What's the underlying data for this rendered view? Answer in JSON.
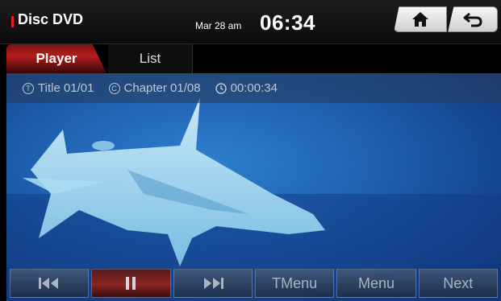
{
  "header": {
    "source_title": "Disc DVD",
    "date": "Mar 28 am",
    "time": "06:34",
    "home_icon": "home-icon",
    "back_icon": "back-arrow-icon"
  },
  "tabs": [
    {
      "label": "Player",
      "active": true
    },
    {
      "label": "List",
      "active": false
    }
  ],
  "info": {
    "title_icon": "T",
    "title": "Title 01/01",
    "chapter_icon": "C",
    "chapter": "Chapter 01/08",
    "elapsed": "00:00:34"
  },
  "controls": {
    "tmenu_label": "TMenu",
    "menu_label": "Menu",
    "next_label": "Next",
    "prev_icon": "skip-previous-icon",
    "pause_icon": "pause-icon",
    "next_icon": "skip-next-icon"
  },
  "colors": {
    "accent_red": "#b41d1d",
    "video_blue": "#1d5cab"
  }
}
